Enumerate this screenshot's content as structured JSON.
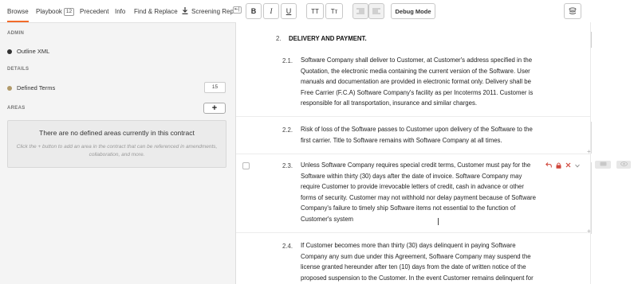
{
  "tabs": [
    {
      "label": "Browse",
      "active": true
    },
    {
      "label": "Playbook",
      "badge": "12"
    },
    {
      "label": "Precedent"
    },
    {
      "label": "Info"
    },
    {
      "label": "Find & Replace"
    },
    {
      "label": "Screening Repo",
      "icon": "download-icon"
    }
  ],
  "toolbar": {
    "bold": "B",
    "italic": "I",
    "underline": "U",
    "caps_upper": "TT",
    "caps_lower": "Tт",
    "debug_label": "Debug Mode",
    "pin_label": "⇤|"
  },
  "left": {
    "admin_header": "ADMIN",
    "outline_label": "Outline XML",
    "details_header": "DETAILS",
    "defined_terms_label": "Defined Terms",
    "defined_terms_count": "15",
    "areas_header": "AREAS",
    "add_label": "+",
    "empty_title": "There are no defined areas currently in this contract",
    "empty_body": "Click the + button to add an area in the contract that can be referenced in amendments, collaboration, and more."
  },
  "colors": {
    "accent": "#f26b2a",
    "outline_dot": "#333333",
    "defined_terms_dot": "#b19a6a",
    "delete_red": "#d0453a"
  },
  "doc": {
    "section_num": "2.",
    "section_title": "DELIVERY AND PAYMENT.",
    "clauses": [
      {
        "num": "2.1.",
        "lines": [
          "Software Company shall deliver to Customer, at Customer's address specified in the",
          "Quotation, the electronic media containing the current version of the Software.  User",
          "manuals and documentation are provided in electronic format only.  Delivery shall be",
          "Free Carrier (F.C.A) Software Company's facility as per Incoterms 2011.  Customer is",
          "responsible for all transportation, insurance and similar charges."
        ]
      },
      {
        "num": "2.2.",
        "lines": [
          "Risk of loss of the Software passes to Customer upon delivery of the Software to the",
          "first carrier.  Title to Software remains with Software Company at all times."
        ]
      },
      {
        "num": "2.3.",
        "lines": [
          "Unless Software Company requires special credit terms, Customer must pay for the",
          "Software within thirty (30) days after the date of invoice.  Software Company may",
          "require Customer to provide irrevocable letters of credit, cash in advance or other",
          "forms of security.  Customer may not withhold nor delay payment because of Software",
          "Company's failure to timely ship Software items not essential to the function of",
          "Customer's system"
        ]
      },
      {
        "num": "2.4.",
        "lines": [
          "If Customer becomes more than thirty (30) days delinquent in paying Software",
          "Company any sum due under this Agreement, Software Company may suspend the",
          "license granted hereunder after ten (10) days from the date of written notice of the",
          "proposed suspension to the Customer.  In the event Customer remains delinquent for"
        ]
      }
    ]
  }
}
